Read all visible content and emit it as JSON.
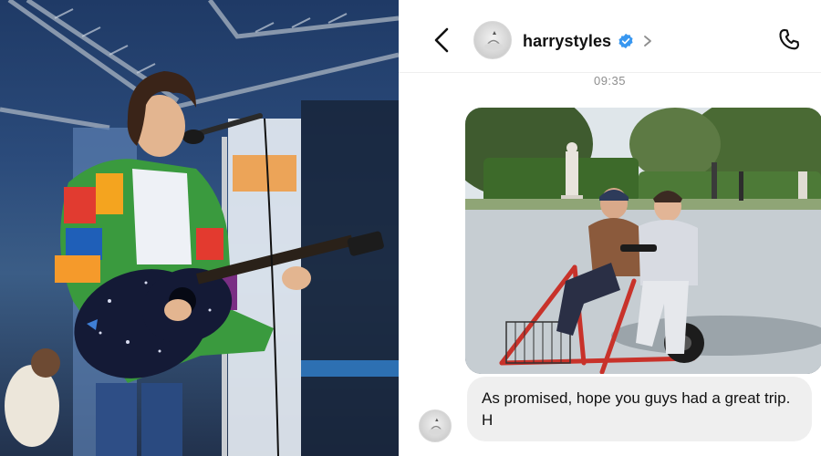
{
  "header": {
    "username": "harrystyles",
    "back_icon": "chevron-left-icon",
    "verified_icon": "verified-badge-icon",
    "profile_chevron_icon": "chevron-right-icon",
    "call_icon": "phone-icon"
  },
  "thread": {
    "timestamp": "09:35",
    "message_text": "As promised, hope you guys had a great trip. H"
  },
  "colors": {
    "verified_blue": "#3897f0",
    "bubble_bg": "#efefef",
    "timestamp_gray": "#8e8e8e"
  }
}
